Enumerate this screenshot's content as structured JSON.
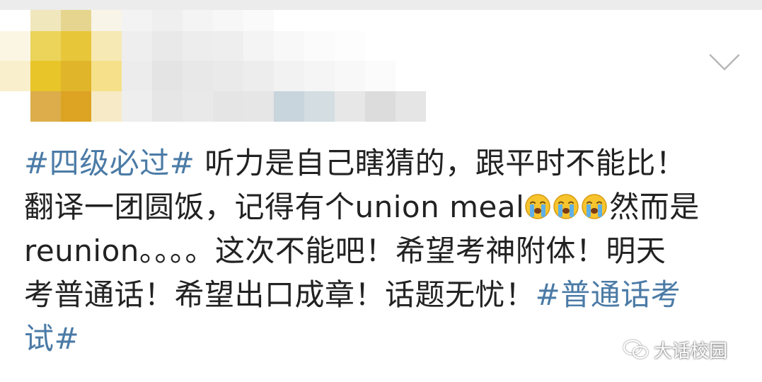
{
  "post": {
    "hashtag_1": "#四级必过#",
    "line_1_text": " 听力是自己瞎猜的，跟平时不能比！",
    "line_2_text_a": "翻译一团圆饭，记得有个union meal",
    "line_2_text_b": "然而是",
    "line_3_text": "reunion。。。。这次不能吧！希望考神附体！明天",
    "line_4_text": "考普通话！希望出口成章！话题无忧！",
    "hashtag_2_part_1": "#普通话考",
    "hashtag_2_part_2": "试#",
    "emoji_name": "crying-face-emoji",
    "emoji_count": 3
  },
  "header": {
    "collapse_icon": "chevron-down-icon",
    "avatar_state": "pixelated"
  },
  "watermark": {
    "icon": "wechat-icon",
    "text": "大话校园"
  },
  "colors": {
    "hashtag": "#4b7ba6",
    "text": "#222222",
    "background": "#ffffff"
  }
}
